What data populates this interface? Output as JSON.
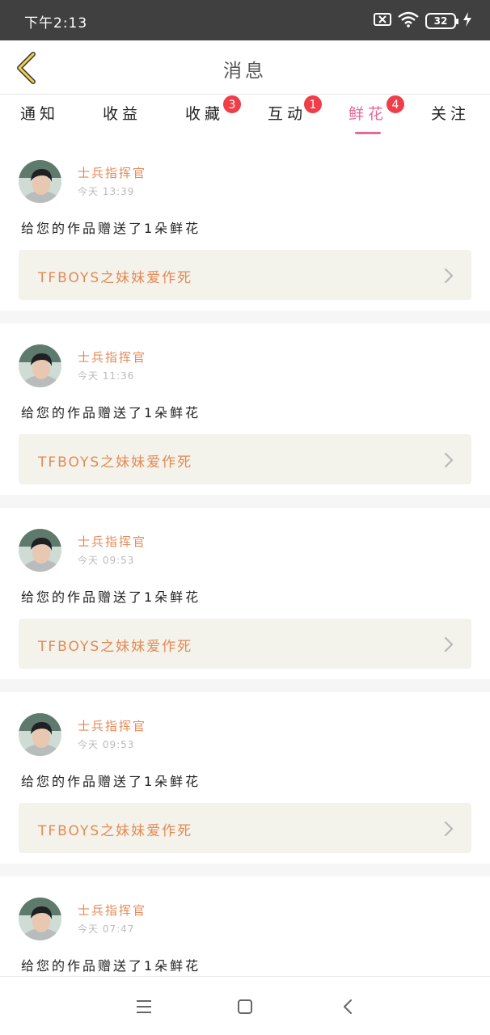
{
  "status_bar": {
    "time": "下午2:13",
    "battery": "32",
    "icons": [
      "sim-error-icon",
      "wifi-icon",
      "battery-icon",
      "charging-icon"
    ]
  },
  "header": {
    "title": "消息",
    "back_icon": "chevron-left-icon"
  },
  "tabs": [
    {
      "label": "通知",
      "badge": null
    },
    {
      "label": "收益",
      "badge": null
    },
    {
      "label": "收藏",
      "badge": "3"
    },
    {
      "label": "互动",
      "badge": "1"
    },
    {
      "label": "鲜花",
      "badge": "4"
    },
    {
      "label": "关注",
      "badge": null
    }
  ],
  "active_tab": "鲜花",
  "colors": {
    "accent": "#e8679a",
    "name": "#e58a58",
    "badge": "#ef3e4a",
    "link_bg": "#f3f3eb"
  },
  "messages": [
    {
      "user": "士兵指挥官",
      "time": "今天 13:39",
      "text": "给您的作品赠送了1朵鲜花",
      "work": "TFBOYS之妹妹爱作死"
    },
    {
      "user": "士兵指挥官",
      "time": "今天 11:36",
      "text": "给您的作品赠送了1朵鲜花",
      "work": "TFBOYS之妹妹爱作死"
    },
    {
      "user": "士兵指挥官",
      "time": "今天 09:53",
      "text": "给您的作品赠送了1朵鲜花",
      "work": "TFBOYS之妹妹爱作死"
    },
    {
      "user": "士兵指挥官",
      "time": "今天 09:53",
      "text": "给您的作品赠送了1朵鲜花",
      "work": "TFBOYS之妹妹爱作死"
    },
    {
      "user": "士兵指挥官",
      "time": "今天 07:47",
      "text": "给您的作品赠送了1朵鲜花",
      "work": "TFBOYS之妹妹爱作死"
    }
  ],
  "nav_bar": {
    "icons": [
      "menu-icon",
      "home-icon",
      "back-icon"
    ]
  }
}
